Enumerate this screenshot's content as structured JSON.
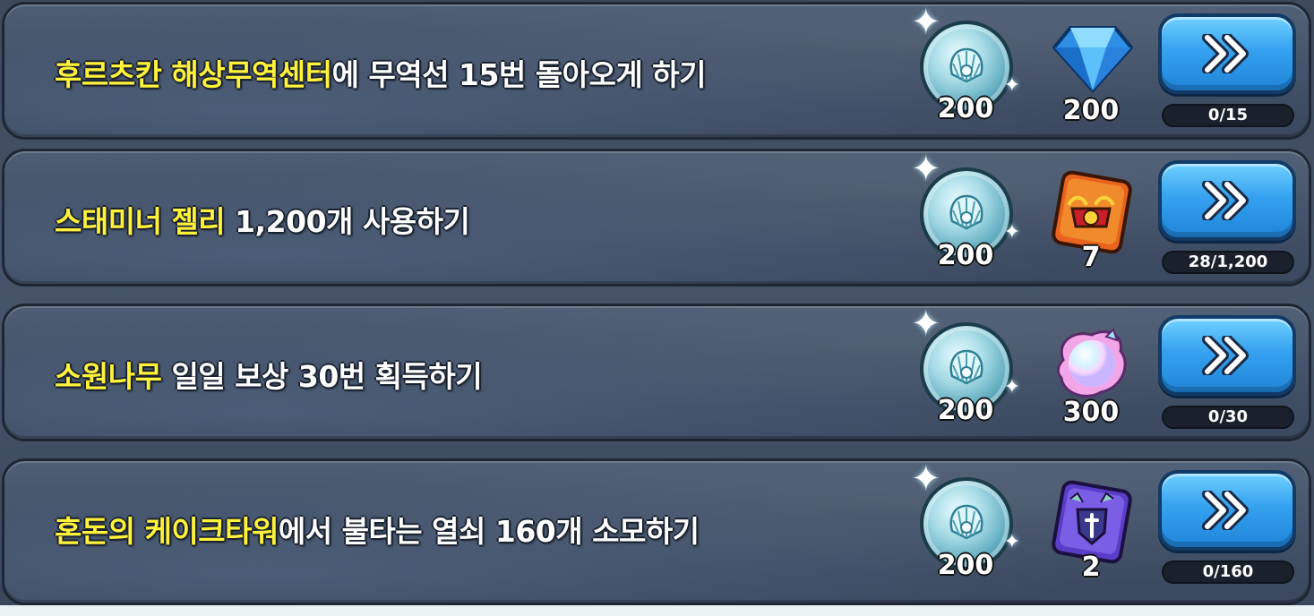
{
  "missions": [
    {
      "title_highlight": "후르츠칸 해상무역센터",
      "title_rest": "에 무역선 15번 돌아오게 하기",
      "shell_reward": "200",
      "item_icon": "crystal-gem-icon",
      "item_reward": "200",
      "progress": "0/15"
    },
    {
      "title_highlight": "스태미너 젤리",
      "title_rest": " 1,200개 사용하기",
      "shell_reward": "200",
      "item_icon": "guild-crest-box-icon",
      "item_reward": "7",
      "progress": "28/1,200"
    },
    {
      "title_highlight": "소원나무",
      "title_rest": " 일일 보상 30번 획득하기",
      "shell_reward": "200",
      "item_icon": "rainbow-pearl-icon",
      "item_reward": "300",
      "progress": "0/30"
    },
    {
      "title_highlight": "혼돈의 케이크타워",
      "title_rest": "에서 불타는 열쇠 160개 소모하기",
      "shell_reward": "200",
      "item_icon": "sword-shield-box-icon",
      "item_reward": "2",
      "progress": "0/160"
    }
  ],
  "colors": {
    "highlight": "#fff23a",
    "button": "#35a2f0",
    "panel": "#435269"
  }
}
